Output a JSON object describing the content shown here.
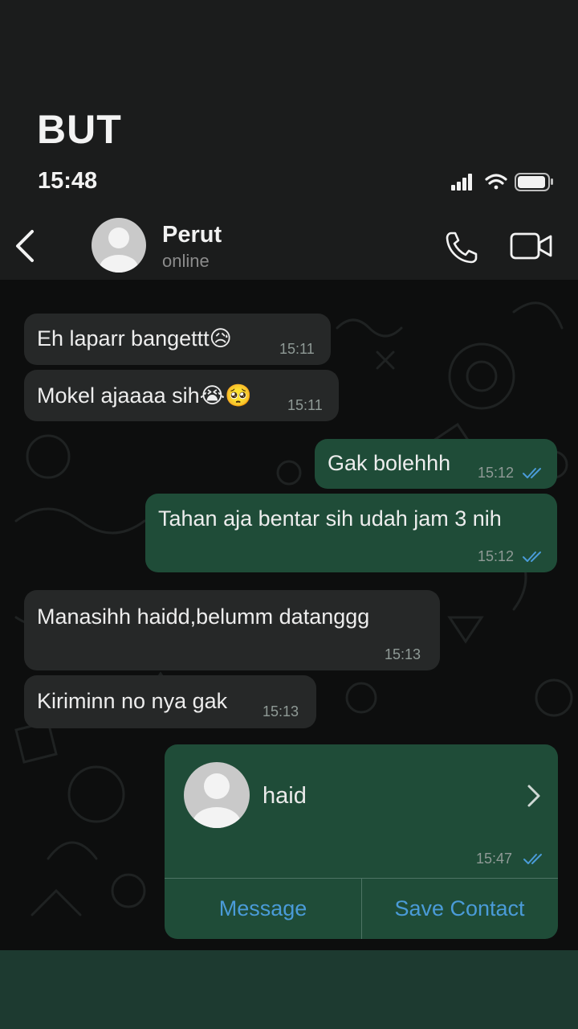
{
  "caption": "BUT",
  "status_bar": {
    "time": "15:48",
    "icons": [
      "signal-icon",
      "wifi-icon",
      "battery-icon"
    ]
  },
  "header": {
    "contact_name": "Perut",
    "contact_status": "online",
    "icons": [
      "back-chevron-icon",
      "avatar-icon",
      "phone-call-icon",
      "video-call-icon"
    ]
  },
  "messages": [
    {
      "direction": "in",
      "text": "Eh laparr bangettt😥",
      "time": "15:11"
    },
    {
      "direction": "in",
      "text": "Mokel ajaaaa sih😭🥺",
      "time": "15:11"
    },
    {
      "direction": "out",
      "text": "Gak bolehhh",
      "time": "15:12",
      "read": true
    },
    {
      "direction": "out",
      "text": "Tahan aja bentar sih udah jam 3 nih",
      "time": "15:12",
      "read": true
    },
    {
      "direction": "in",
      "text": "Manasihh haidd,belumm datanggg",
      "time": "15:13"
    },
    {
      "direction": "in",
      "text": "Kiriminn no nya gak",
      "time": "15:13"
    }
  ],
  "contact_card": {
    "name": "haid",
    "time": "15:47",
    "read": true,
    "message_label": "Message",
    "save_label": "Save Contact"
  },
  "colors": {
    "incoming_bubble": "#262828",
    "outgoing_bubble": "#1f4c38",
    "link_blue": "#4a9bd8",
    "read_tick": "#4a9bd8"
  }
}
